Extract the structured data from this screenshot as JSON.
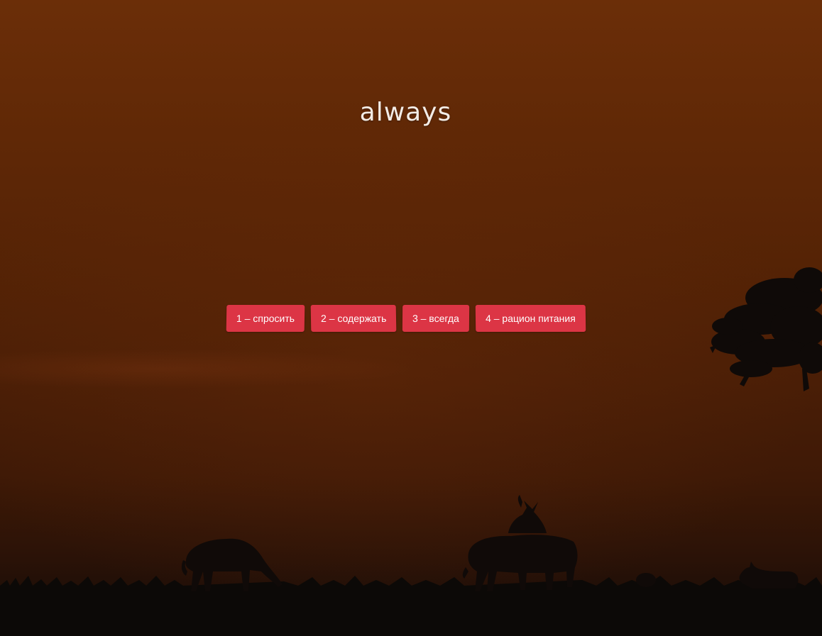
{
  "page": {
    "title": "always"
  },
  "buttons": [
    {
      "label": "1 – спросить"
    },
    {
      "label": "2 – содержать"
    },
    {
      "label": "3 – всегда"
    },
    {
      "label": "4 – рацион питания"
    }
  ],
  "colors": {
    "button_bg": "#dc3545",
    "button_text": "#ffffff",
    "title_text": "#f3ece6",
    "sky_top": "#6b2e08",
    "ground": "#120a08"
  },
  "background": {
    "scene": "sunset-savanna",
    "silhouettes": [
      "tree-silhouette",
      "antelope-silhouette"
    ]
  }
}
